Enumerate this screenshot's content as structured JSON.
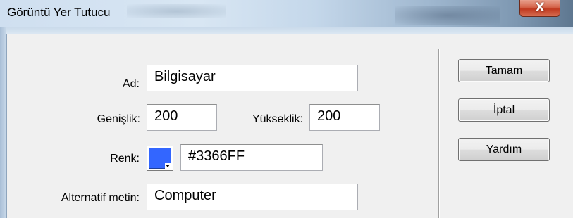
{
  "window": {
    "title": "Görüntü Yer Tutucu",
    "close_glyph": "X"
  },
  "form": {
    "name": {
      "label": "Ad:",
      "value": "Bilgisayar"
    },
    "width": {
      "label": "Genişlik:",
      "value": "200"
    },
    "height": {
      "label": "Yükseklik:",
      "value": "200"
    },
    "color": {
      "label": "Renk:",
      "value": "#3366FF",
      "swatch_color": "#3366FF"
    },
    "alt_text": {
      "label": "Alternatif metin:",
      "value": "Computer"
    }
  },
  "buttons": {
    "ok": "Tamam",
    "cancel": "İptal",
    "help": "Yardım"
  }
}
